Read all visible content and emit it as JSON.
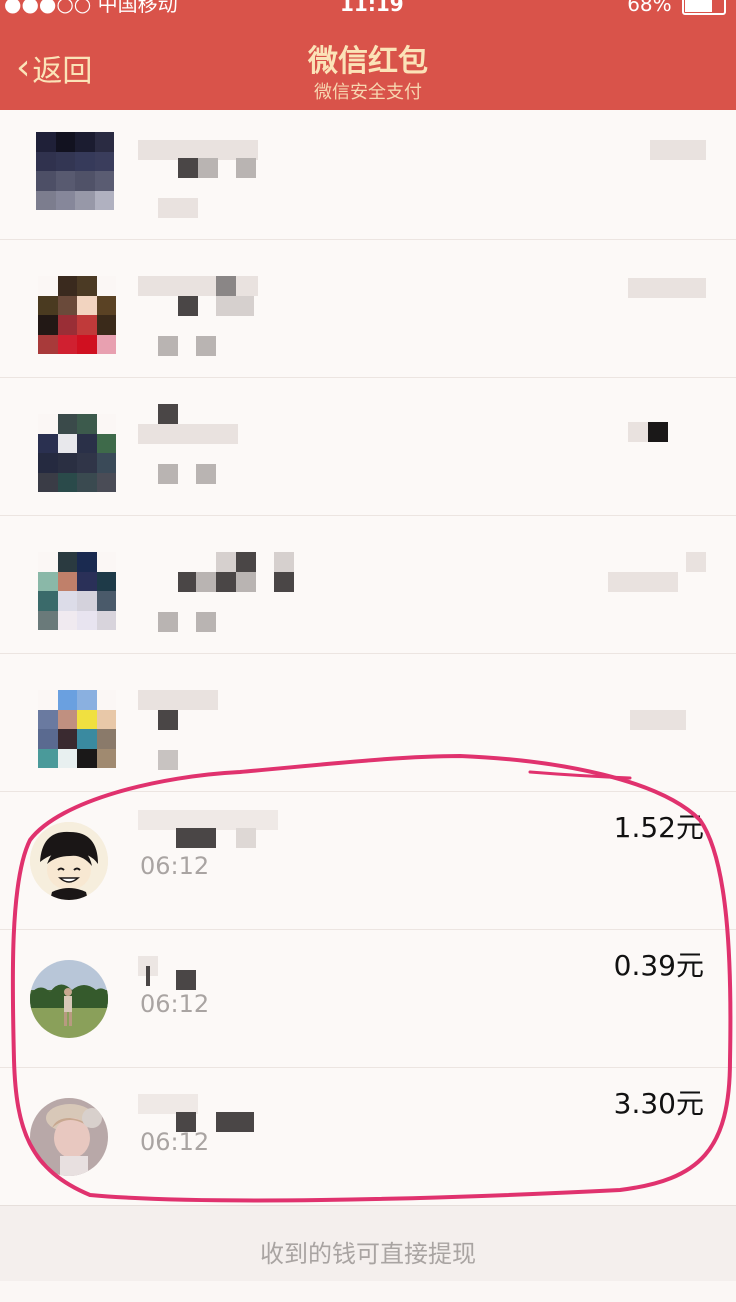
{
  "status_bar": {
    "carrier": "●●●○○ 中国移动",
    "time": "11:19",
    "battery": "68%",
    "battery_level": 0.68
  },
  "nav": {
    "back_label": "返回",
    "title": "微信红包",
    "subtitle": "微信安全支付"
  },
  "records": [
    {
      "time": "06:12",
      "amount": "1.52元"
    },
    {
      "time": "06:12",
      "amount": "0.39元"
    },
    {
      "time": "06:12",
      "amount": "3.30元"
    }
  ],
  "footer": {
    "text": "收到的钱可直接提现"
  },
  "colors": {
    "nav_bg": "#d9534a",
    "nav_text": "#fbe3b8",
    "highlight": "#e0326e"
  }
}
